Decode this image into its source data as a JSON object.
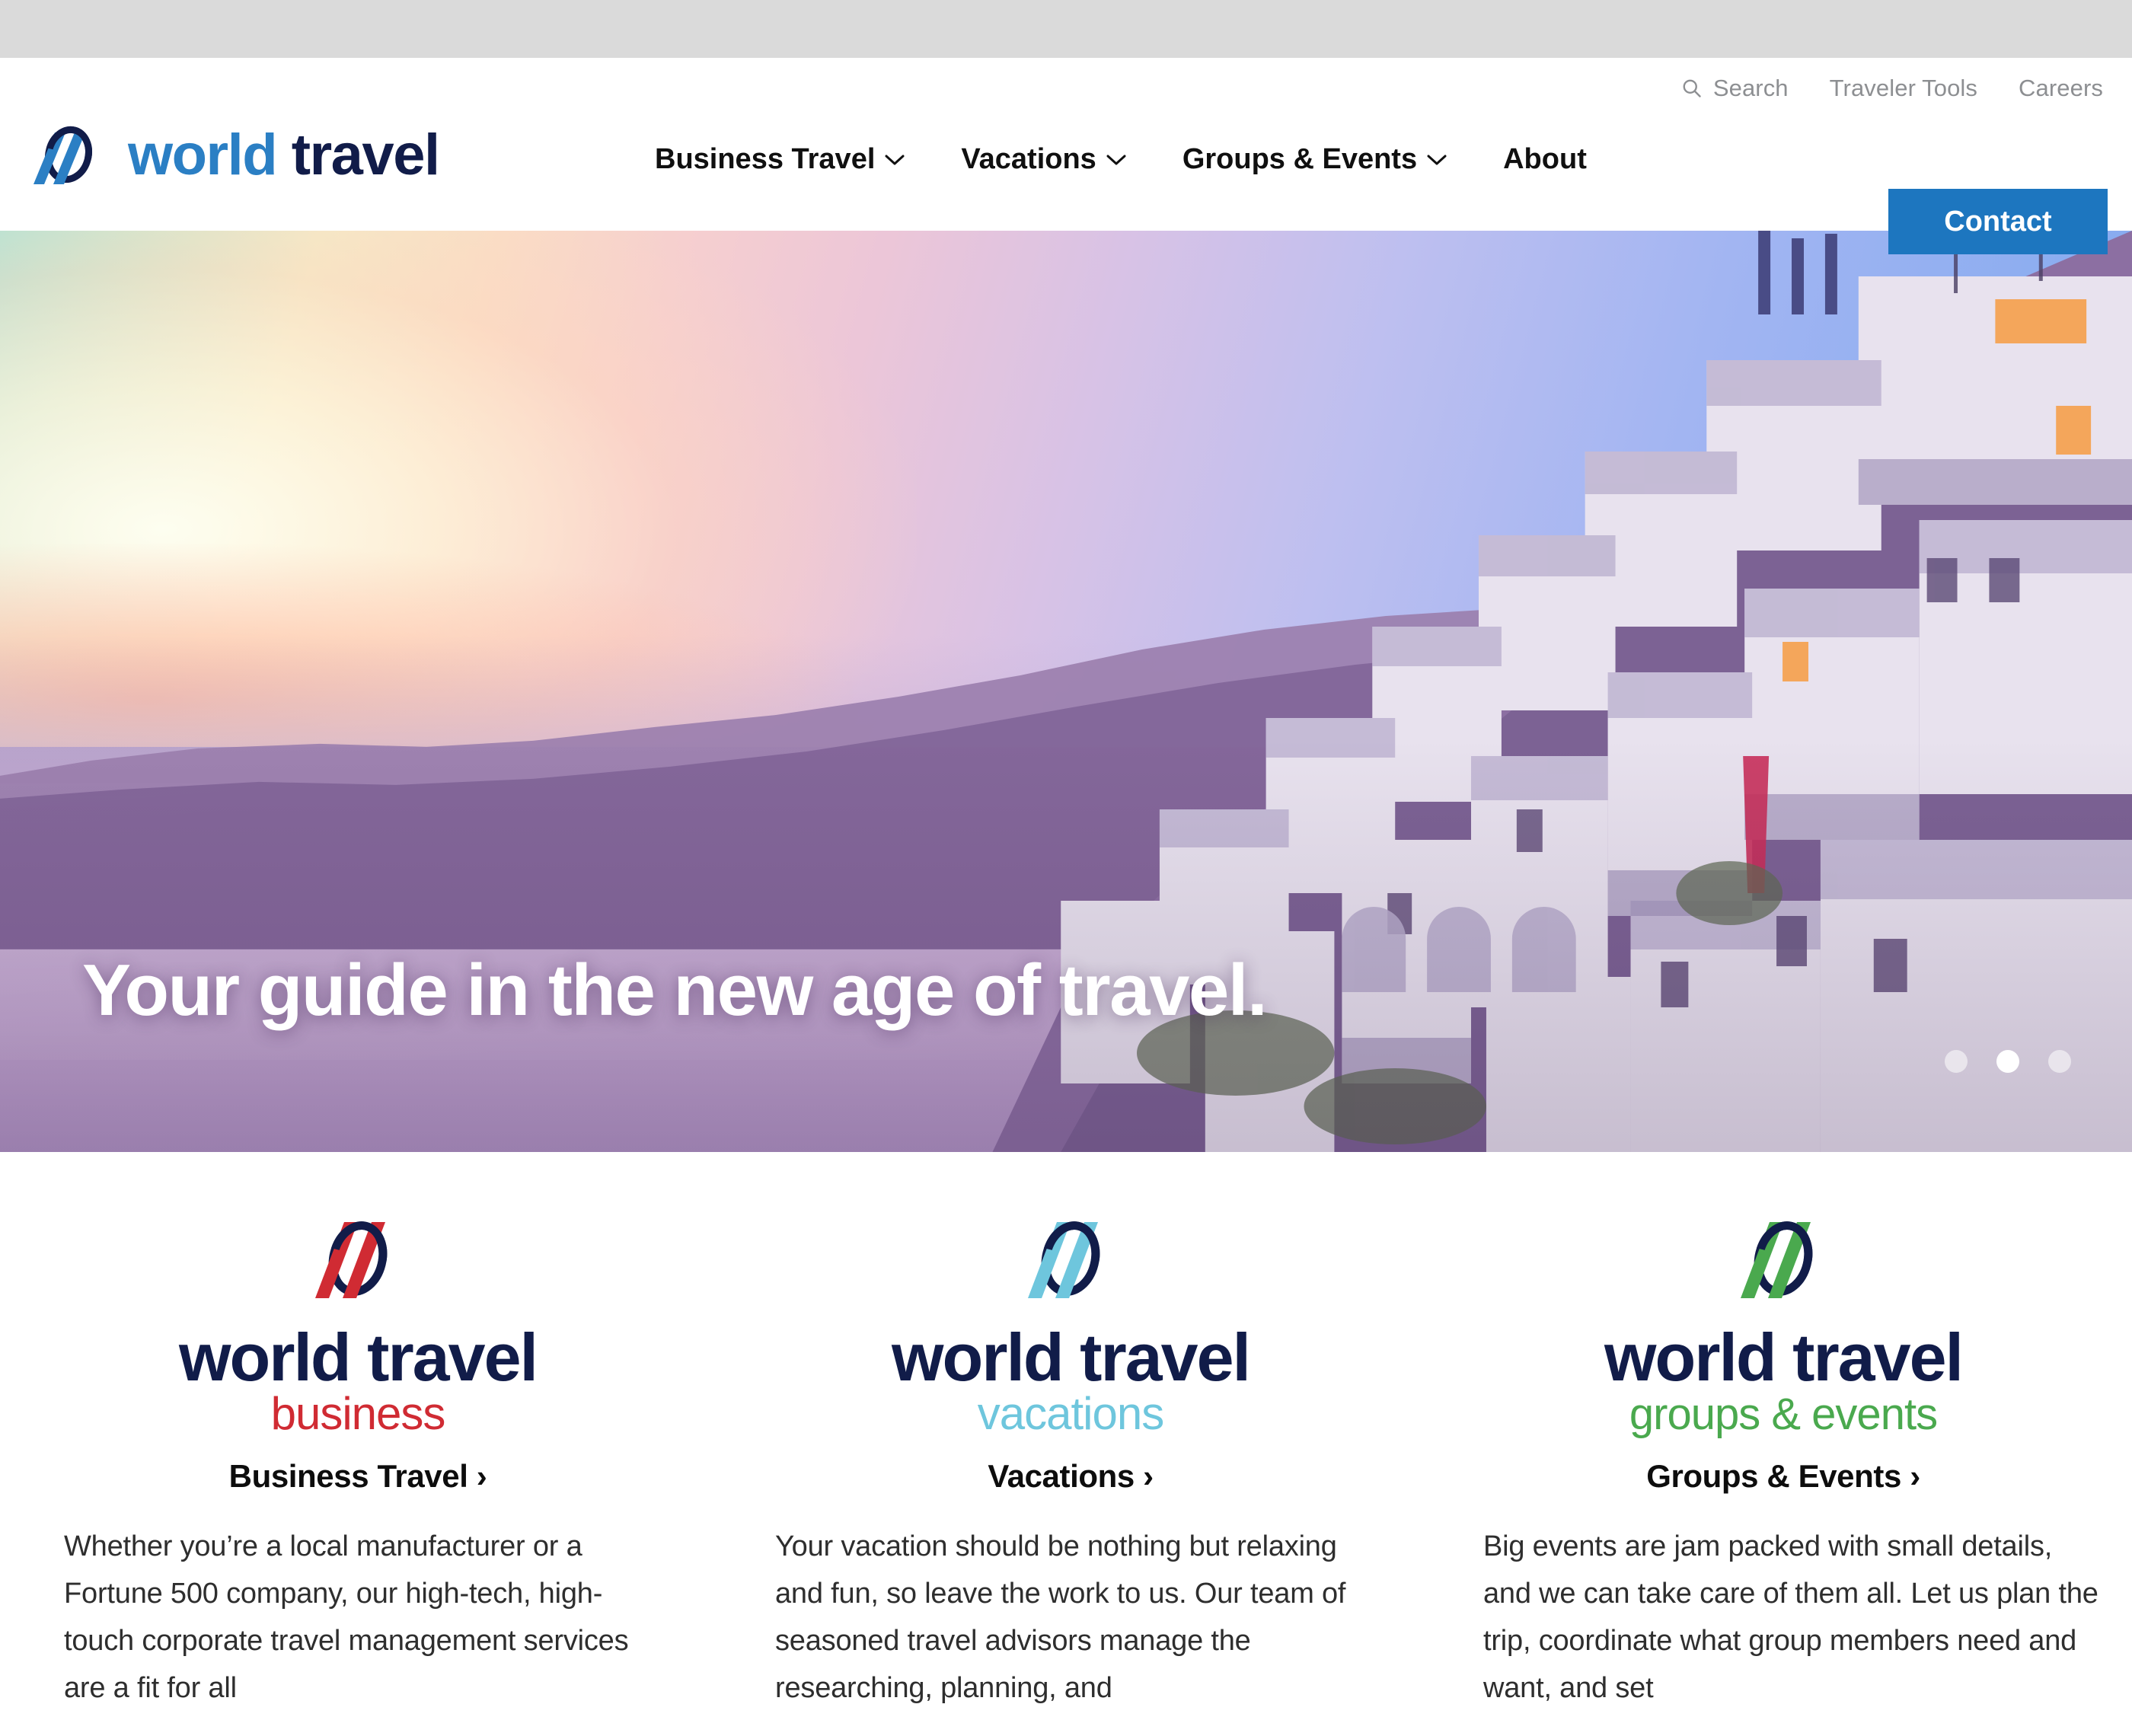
{
  "brand": {
    "name_part1": "world",
    "name_part2": " travel",
    "colors": {
      "blue": "#2b7fc4",
      "navy": "#111c49",
      "button_blue": "#1d76bf",
      "red": "#d02b33",
      "cyan": "#6ec6dd",
      "green": "#4aa94e",
      "utility_gray": "#8d8f92"
    }
  },
  "utility_nav": {
    "search_label": "Search",
    "items": [
      {
        "label": "Traveler Tools"
      },
      {
        "label": "Careers"
      }
    ]
  },
  "main_nav": {
    "items": [
      {
        "label": "Business Travel",
        "has_caret": true
      },
      {
        "label": "Vacations",
        "has_caret": true
      },
      {
        "label": "Groups & Events",
        "has_caret": true
      },
      {
        "label": "About",
        "has_caret": false
      }
    ],
    "contact_label": "Contact"
  },
  "hero": {
    "headline": "Your guide in the new age of travel.",
    "scene": "santorini-cliffside-village-at-sunset",
    "carousel": {
      "total": 3,
      "active_index": 1
    }
  },
  "services": [
    {
      "logo_word1": "world",
      "logo_word2": "travel",
      "logo_sub": "business",
      "accent": "#d02b33",
      "heading": "Business Travel ›",
      "body": "Whether you’re a local manufacturer or a Fortune 500 company, our high-tech, high-touch corporate travel management services are a fit for all"
    },
    {
      "logo_word1": "world",
      "logo_word2": "travel",
      "logo_sub": "vacations",
      "accent": "#6ec6dd",
      "heading": "Vacations ›",
      "body": "Your vacation should be nothing but relaxing and fun, so leave the work to us. Our team of seasoned travel advisors manage the researching, planning, and"
    },
    {
      "logo_word1": "world",
      "logo_word2": "travel",
      "logo_sub": "groups & events",
      "accent": "#4aa94e",
      "heading": "Groups & Events ›",
      "body": "Big events are jam packed with small details, and we can take care of them all. Let us plan the trip, coordinate what group members need and want, and set"
    }
  ]
}
